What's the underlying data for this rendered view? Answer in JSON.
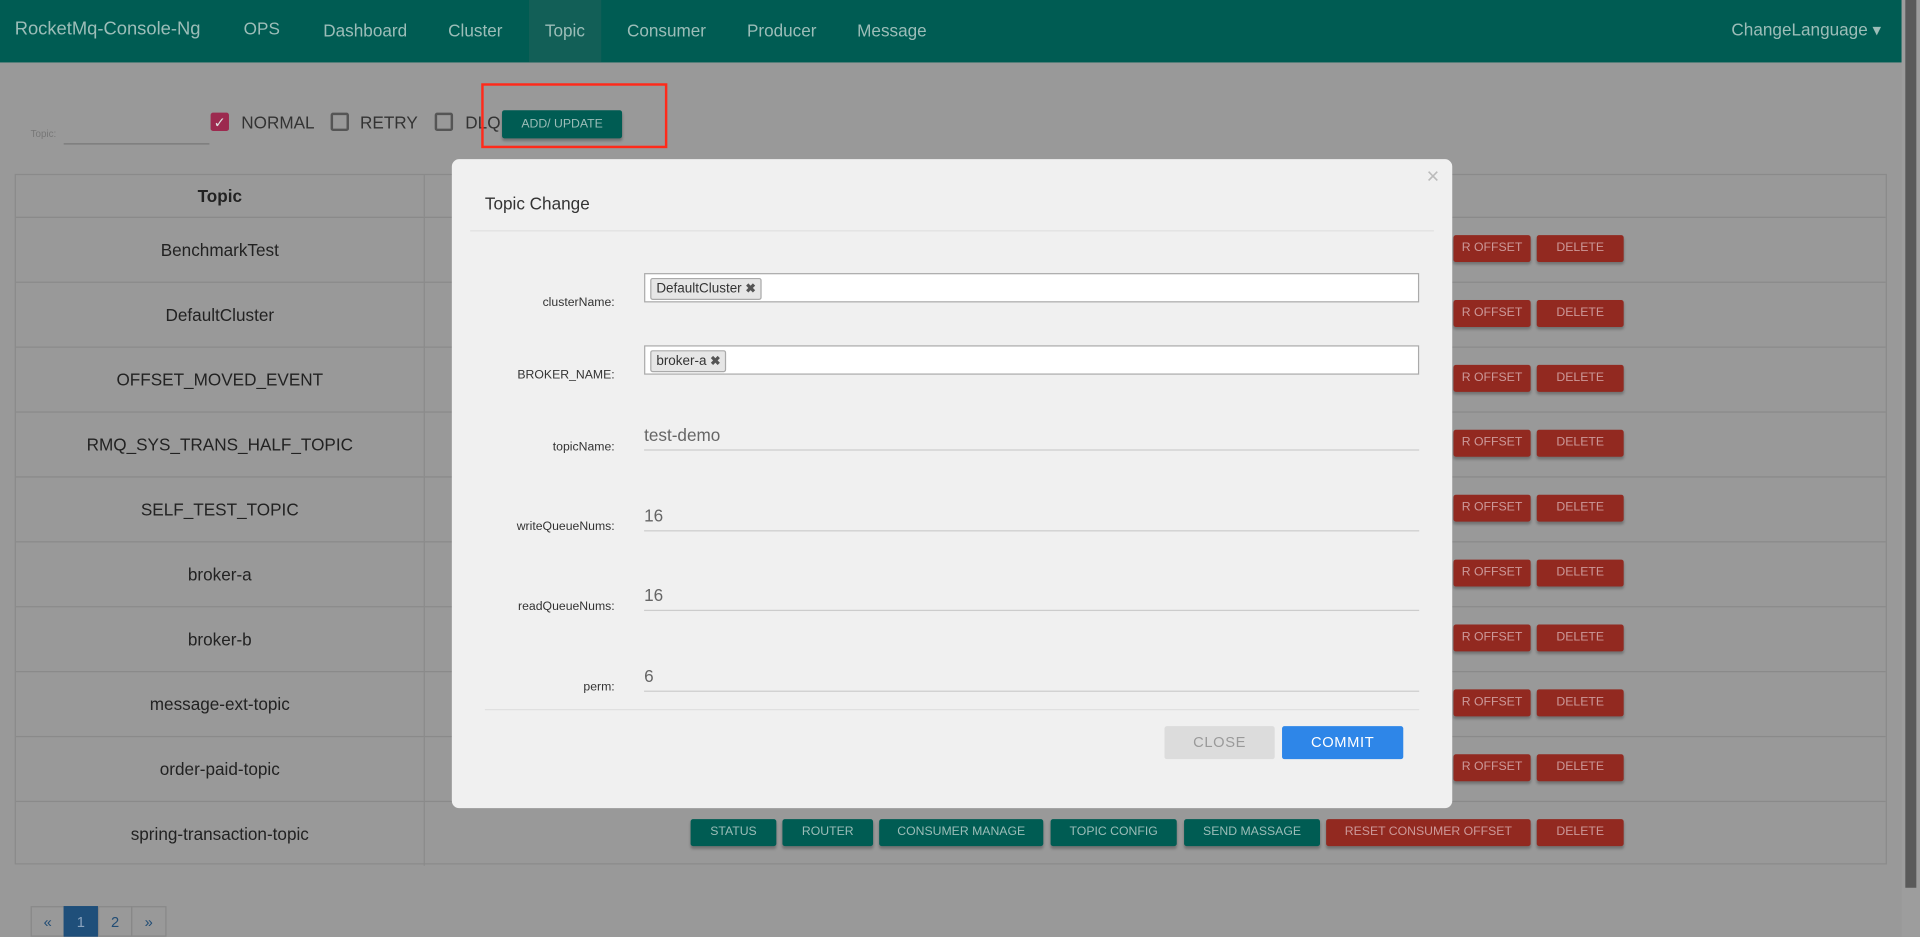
{
  "navbar": {
    "brand": "RocketMq-Console-Ng",
    "items": [
      {
        "label": "OPS"
      },
      {
        "label": "Dashboard"
      },
      {
        "label": "Cluster"
      },
      {
        "label": "Topic",
        "active": true
      },
      {
        "label": "Consumer"
      },
      {
        "label": "Producer"
      },
      {
        "label": "Message"
      }
    ],
    "language": "ChangeLanguage ▾"
  },
  "filters": {
    "topic_label": "Topic:",
    "topic_value": "",
    "checkboxes": [
      {
        "label": "NORMAL",
        "checked": true
      },
      {
        "label": "RETRY",
        "checked": false
      },
      {
        "label": "DLQ",
        "checked": false
      }
    ],
    "add_update": "ADD/ UPDATE"
  },
  "table": {
    "header": "Topic",
    "rows": [
      "BenchmarkTest",
      "DefaultCluster",
      "OFFSET_MOVED_EVENT",
      "RMQ_SYS_TRANS_HALF_TOPIC",
      "SELF_TEST_TOPIC",
      "broker-a",
      "broker-b",
      "message-ext-topic",
      "order-paid-topic",
      "spring-transaction-topic"
    ],
    "actions": [
      "STATUS",
      "ROUTER",
      "CONSUMER MANAGE",
      "TOPIC CONFIG",
      "SEND MASSAGE",
      "RESET CONSUMER OFFSET",
      "DELETE"
    ],
    "partial_reset": "R OFFSET"
  },
  "modal": {
    "title": "Topic Change",
    "close_icon": "×",
    "fields": {
      "clusterName": {
        "label": "clusterName:",
        "tag": "DefaultCluster"
      },
      "brokerName": {
        "label": "BROKER_NAME:",
        "tag": "broker-a"
      },
      "topicName": {
        "label": "topicName:",
        "value": "test-demo"
      },
      "writeQueueNums": {
        "label": "writeQueueNums:",
        "value": "16"
      },
      "readQueueNums": {
        "label": "readQueueNums:",
        "value": "16"
      },
      "perm": {
        "label": "perm:",
        "value": "6"
      }
    },
    "close": "CLOSE",
    "commit": "COMMIT"
  },
  "pagination": {
    "prev": "«",
    "pages": [
      "1",
      "2"
    ],
    "current": "1",
    "next": "»"
  },
  "colors": {
    "navbar": "#005c53",
    "danger": "#922920",
    "primary": "#2e86e8",
    "highlight_box": "#ff2a1a"
  }
}
